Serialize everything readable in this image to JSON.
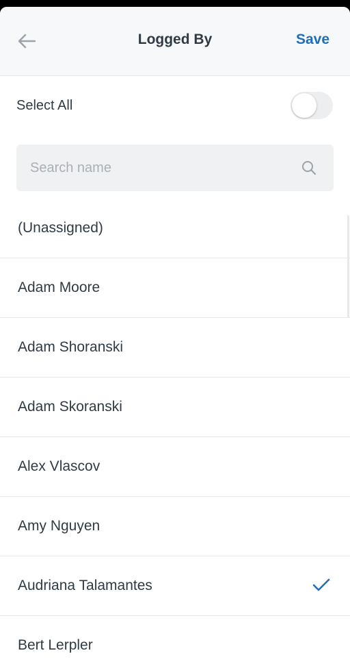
{
  "header": {
    "title": "Logged By",
    "save_label": "Save",
    "back_icon": "arrow-left-icon"
  },
  "select_all": {
    "label": "Select All",
    "enabled": false
  },
  "search": {
    "placeholder": "Search name",
    "value": "",
    "icon": "search-icon"
  },
  "list": {
    "items": [
      {
        "label": "(Unassigned)",
        "selected": false
      },
      {
        "label": "Adam Moore",
        "selected": false
      },
      {
        "label": "Adam Shoranski",
        "selected": false
      },
      {
        "label": "Adam Skoranski",
        "selected": false
      },
      {
        "label": "Alex Vlascov",
        "selected": false
      },
      {
        "label": "Amy Nguyen",
        "selected": false
      },
      {
        "label": "Audriana Talamantes",
        "selected": true
      },
      {
        "label": "Bert Lerpler",
        "selected": false
      }
    ]
  },
  "colors": {
    "accent": "#1f6fb8",
    "text": "#2f3a45",
    "header_bg": "#f7f8f9",
    "divider": "#e6e8ea"
  }
}
